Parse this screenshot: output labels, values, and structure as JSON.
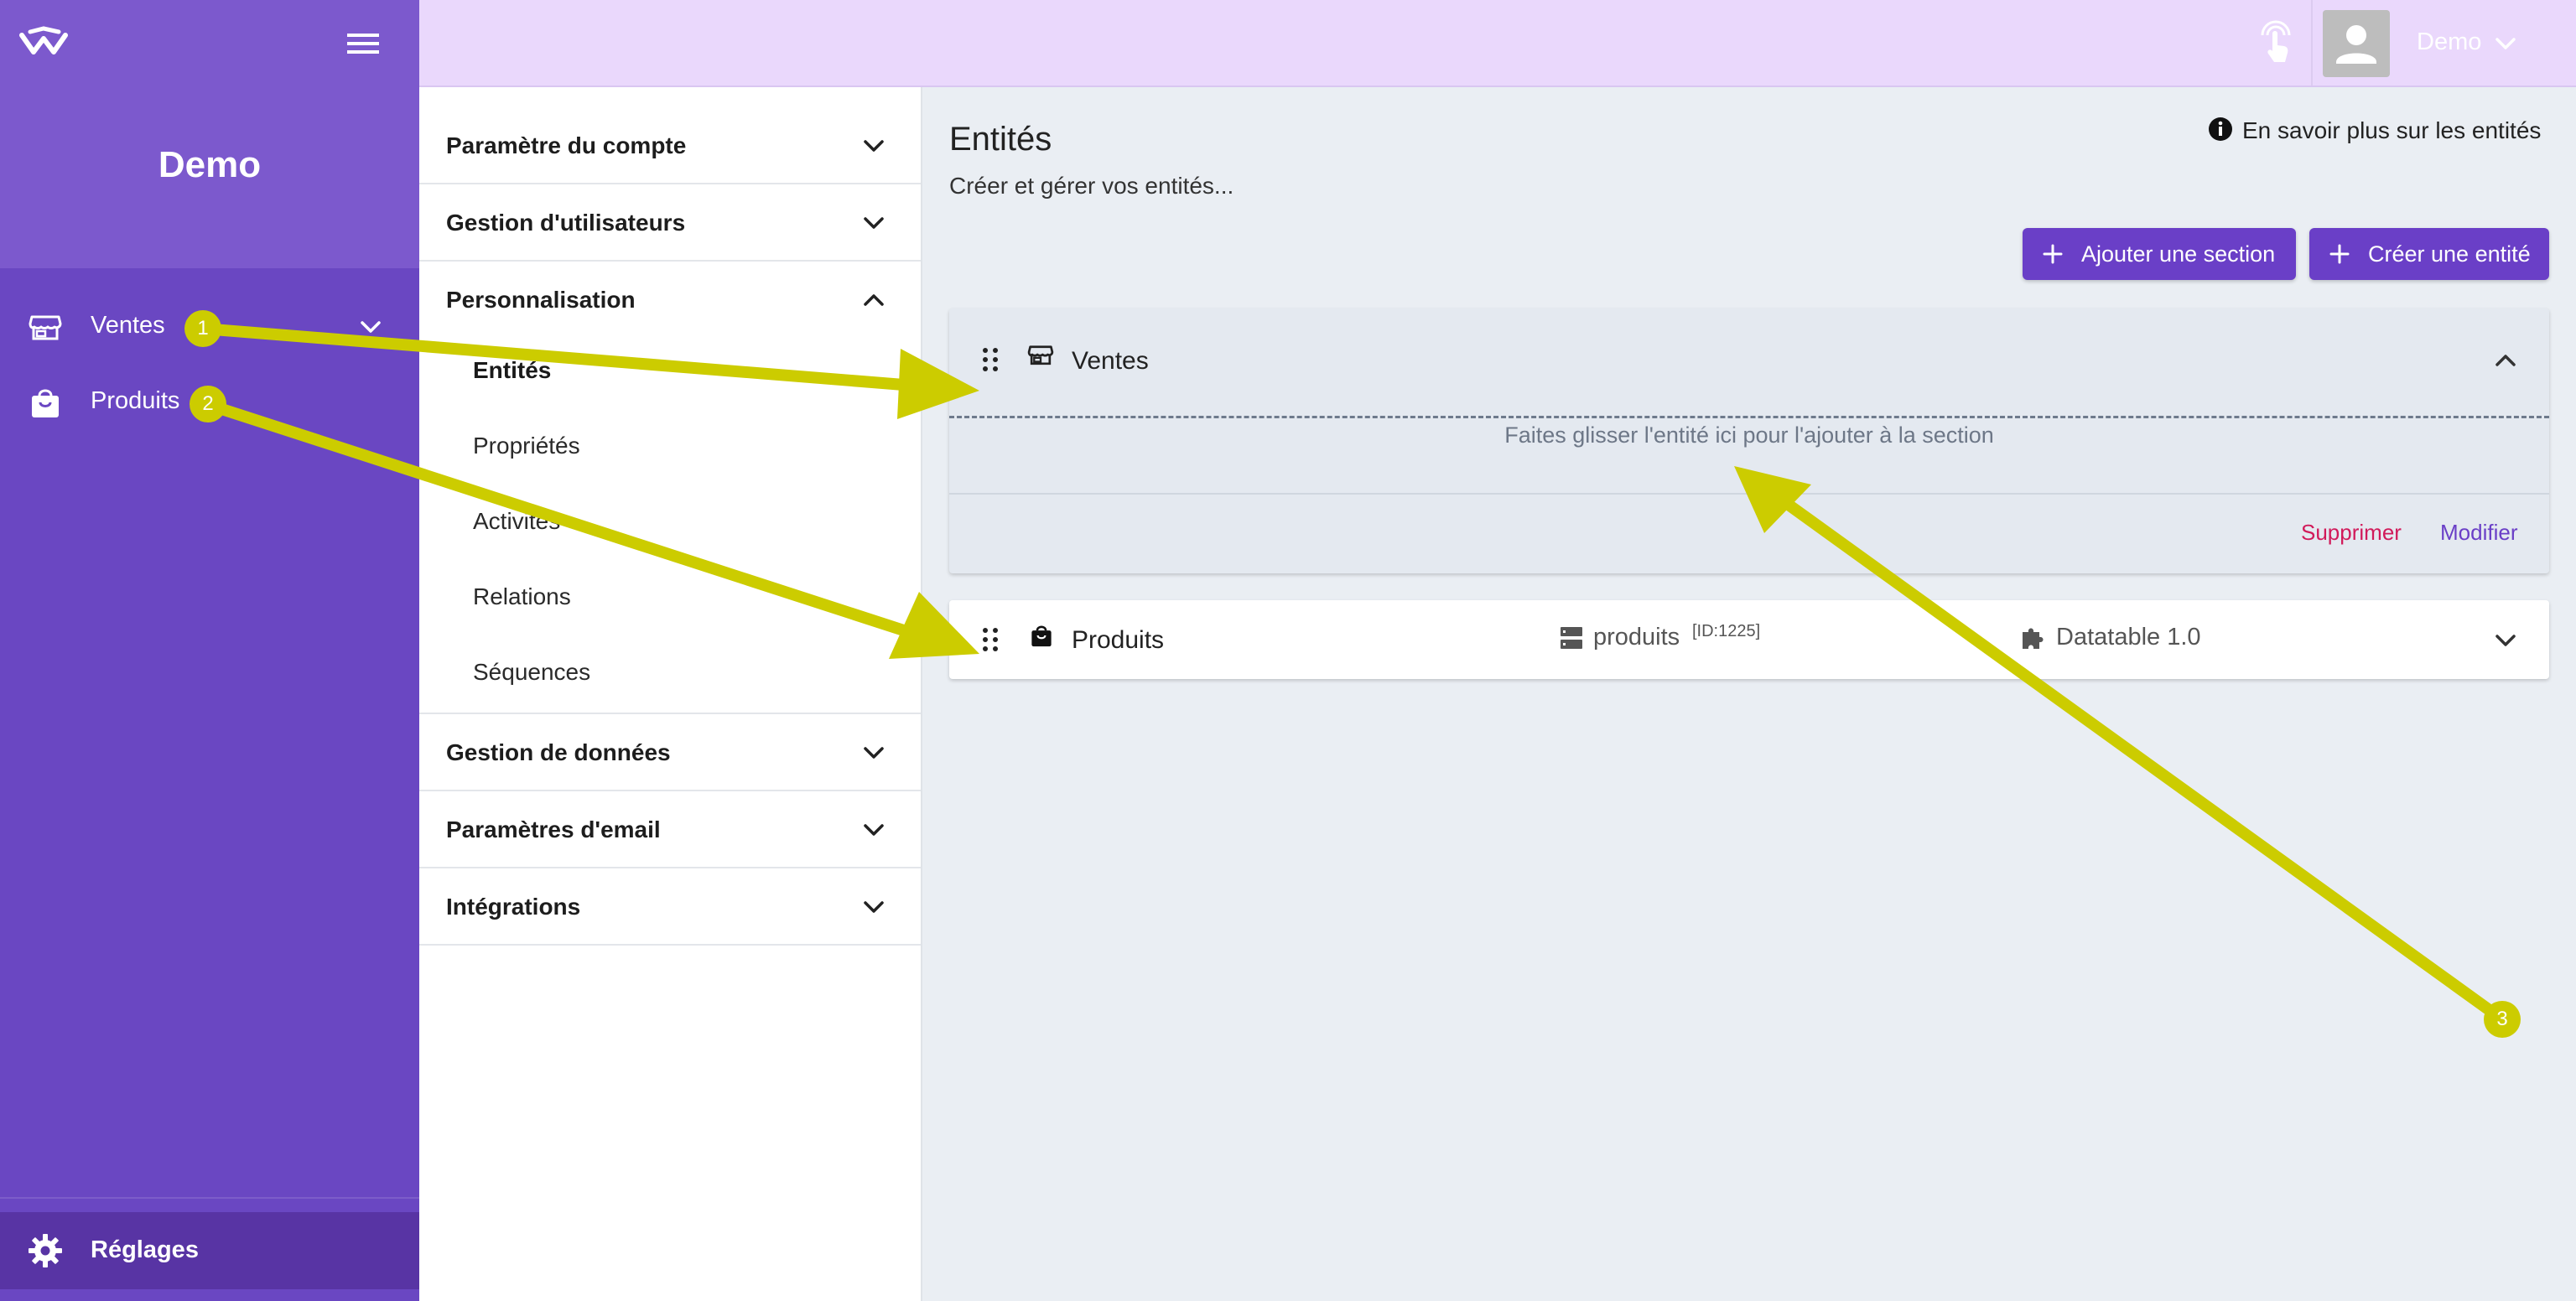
{
  "brand": {
    "name": "Demo"
  },
  "sidebar": {
    "items": [
      {
        "label": "Ventes",
        "icon": "store-icon"
      },
      {
        "label": "Produits",
        "icon": "shopping-bag-icon"
      }
    ],
    "settings_label": "Réglages"
  },
  "topbar": {
    "user_name": "Demo"
  },
  "settings_menu": {
    "sections": [
      {
        "label": "Paramètre du compte"
      },
      {
        "label": "Gestion d'utilisateurs"
      },
      {
        "label": "Personnalisation",
        "expanded": true,
        "items": [
          "Entités",
          "Propriétés",
          "Activités",
          "Relations",
          "Séquences"
        ],
        "active": "Entités"
      },
      {
        "label": "Gestion de données"
      },
      {
        "label": "Paramètres d'email"
      },
      {
        "label": "Intégrations"
      }
    ]
  },
  "main": {
    "title": "Entités",
    "subtitle": "Créer et gérer vos entités...",
    "info_link": "En savoir plus sur les entités",
    "add_section_label": "Ajouter une section",
    "create_entity_label": "Créer une entité",
    "section": {
      "title": "Ventes",
      "drop_hint": "Faites glisser l'entité ici pour l'ajouter à la section",
      "delete_label": "Supprimer",
      "edit_label": "Modifier"
    },
    "entity": {
      "name": "Produits",
      "table": "produits",
      "table_id": "[ID:1225]",
      "plugin": "Datatable 1.0"
    }
  },
  "annotations": {
    "badges": [
      "1",
      "2",
      "3"
    ]
  },
  "colors": {
    "sidebar": "#6a47c2",
    "sidebar_header": "#7c59cd",
    "topbar": "#ead8fc",
    "accent": "#6a3fc7",
    "danger": "#d11a5a",
    "annotation": "#cccc00"
  }
}
